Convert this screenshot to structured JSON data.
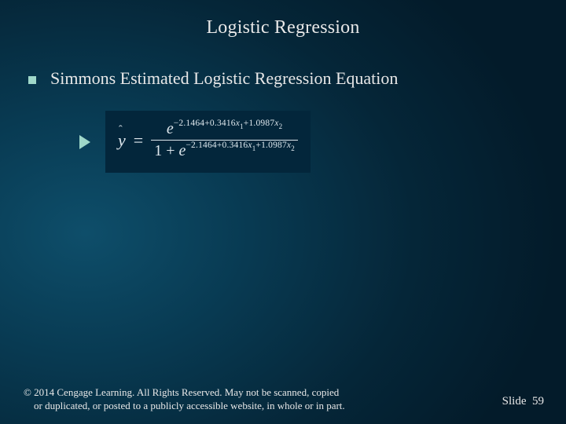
{
  "title": "Logistic Regression",
  "bullet": "Simmons Estimated Logistic Regression Equation",
  "equation": {
    "lhs": "y",
    "hat": "ˆ",
    "equals": "=",
    "e": "e",
    "one_plus": "1 + ",
    "exp_a": "−2.1464+0.3416",
    "x1": "x",
    "s1": "1",
    "exp_b": "+1.0987",
    "x2": "x",
    "s2": "2"
  },
  "footer": {
    "copyright_l1": "© 2014  Cengage Learning.  All Rights Reserved.  May not be scanned, copied",
    "copyright_l2": "or duplicated, or posted to a publicly accessible website, in whole or in part.",
    "slide_label": "Slide",
    "slide_number": "59"
  }
}
